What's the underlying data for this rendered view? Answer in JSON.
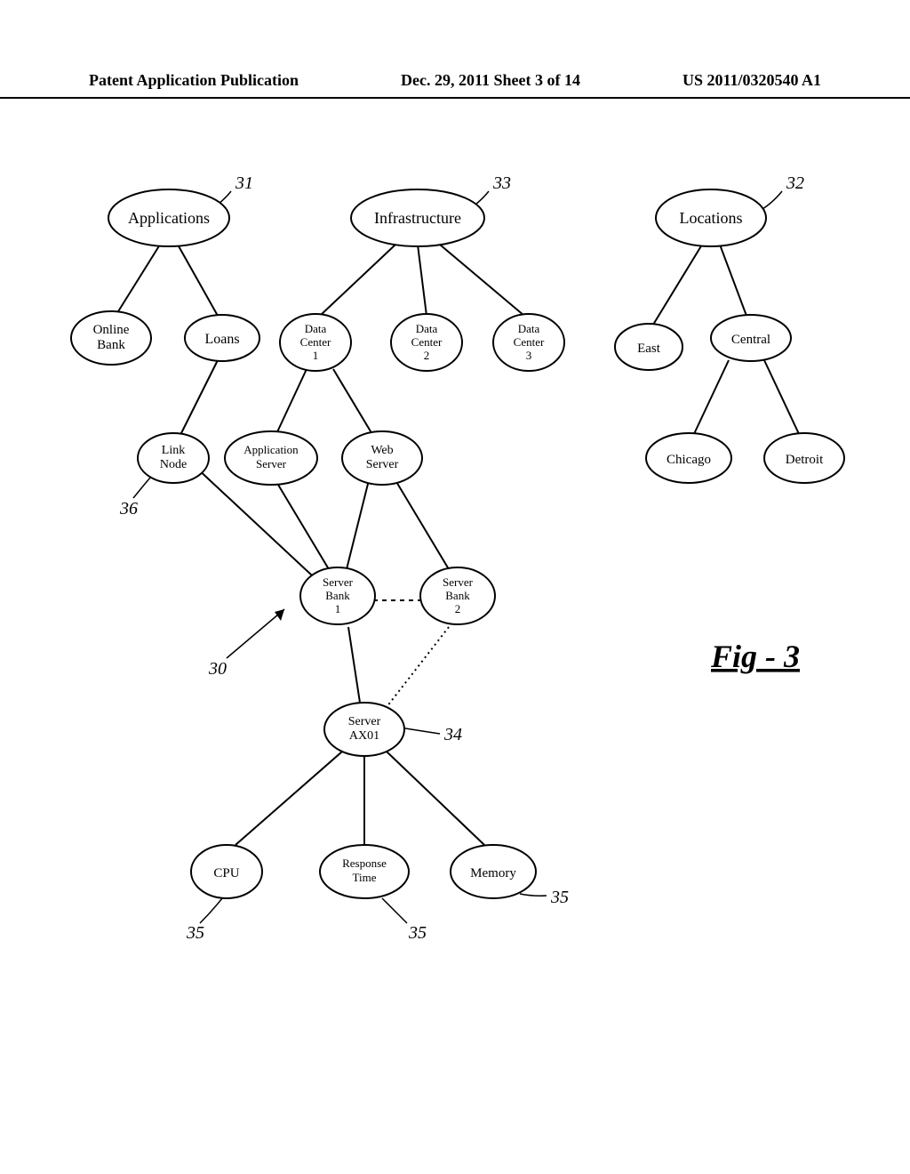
{
  "header": {
    "left": "Patent Application Publication",
    "center": "Dec. 29, 2011  Sheet 3 of 14",
    "right": "US 2011/0320540 A1"
  },
  "figure_label": "Fig - 3",
  "nodes": {
    "applications": "Applications",
    "online_bank_1": "Online",
    "online_bank_2": "Bank",
    "loans": "Loans",
    "link_node_1": "Link",
    "link_node_2": "Node",
    "infrastructure": "Infrastructure",
    "dc1_1": "Data",
    "dc1_2": "Center",
    "dc1_3": "1",
    "dc2_1": "Data",
    "dc2_2": "Center",
    "dc2_3": "2",
    "dc3_1": "Data",
    "dc3_2": "Center",
    "dc3_3": "3",
    "app_server_1": "Application",
    "app_server_2": "Server",
    "web_server_1": "Web",
    "web_server_2": "Server",
    "sb1_1": "Server",
    "sb1_2": "Bank",
    "sb1_3": "1",
    "sb2_1": "Server",
    "sb2_2": "Bank",
    "sb2_3": "2",
    "server_ax01_1": "Server",
    "server_ax01_2": "AX01",
    "cpu": "CPU",
    "response_time_1": "Response",
    "response_time_2": "Time",
    "memory": "Memory",
    "locations": "Locations",
    "east": "East",
    "central": "Central",
    "chicago": "Chicago",
    "detroit": "Detroit"
  },
  "refs": {
    "r31": "31",
    "r32": "32",
    "r33": "33",
    "r30": "30",
    "r34": "34",
    "r35a": "35",
    "r35b": "35",
    "r35c": "35",
    "r36": "36"
  }
}
